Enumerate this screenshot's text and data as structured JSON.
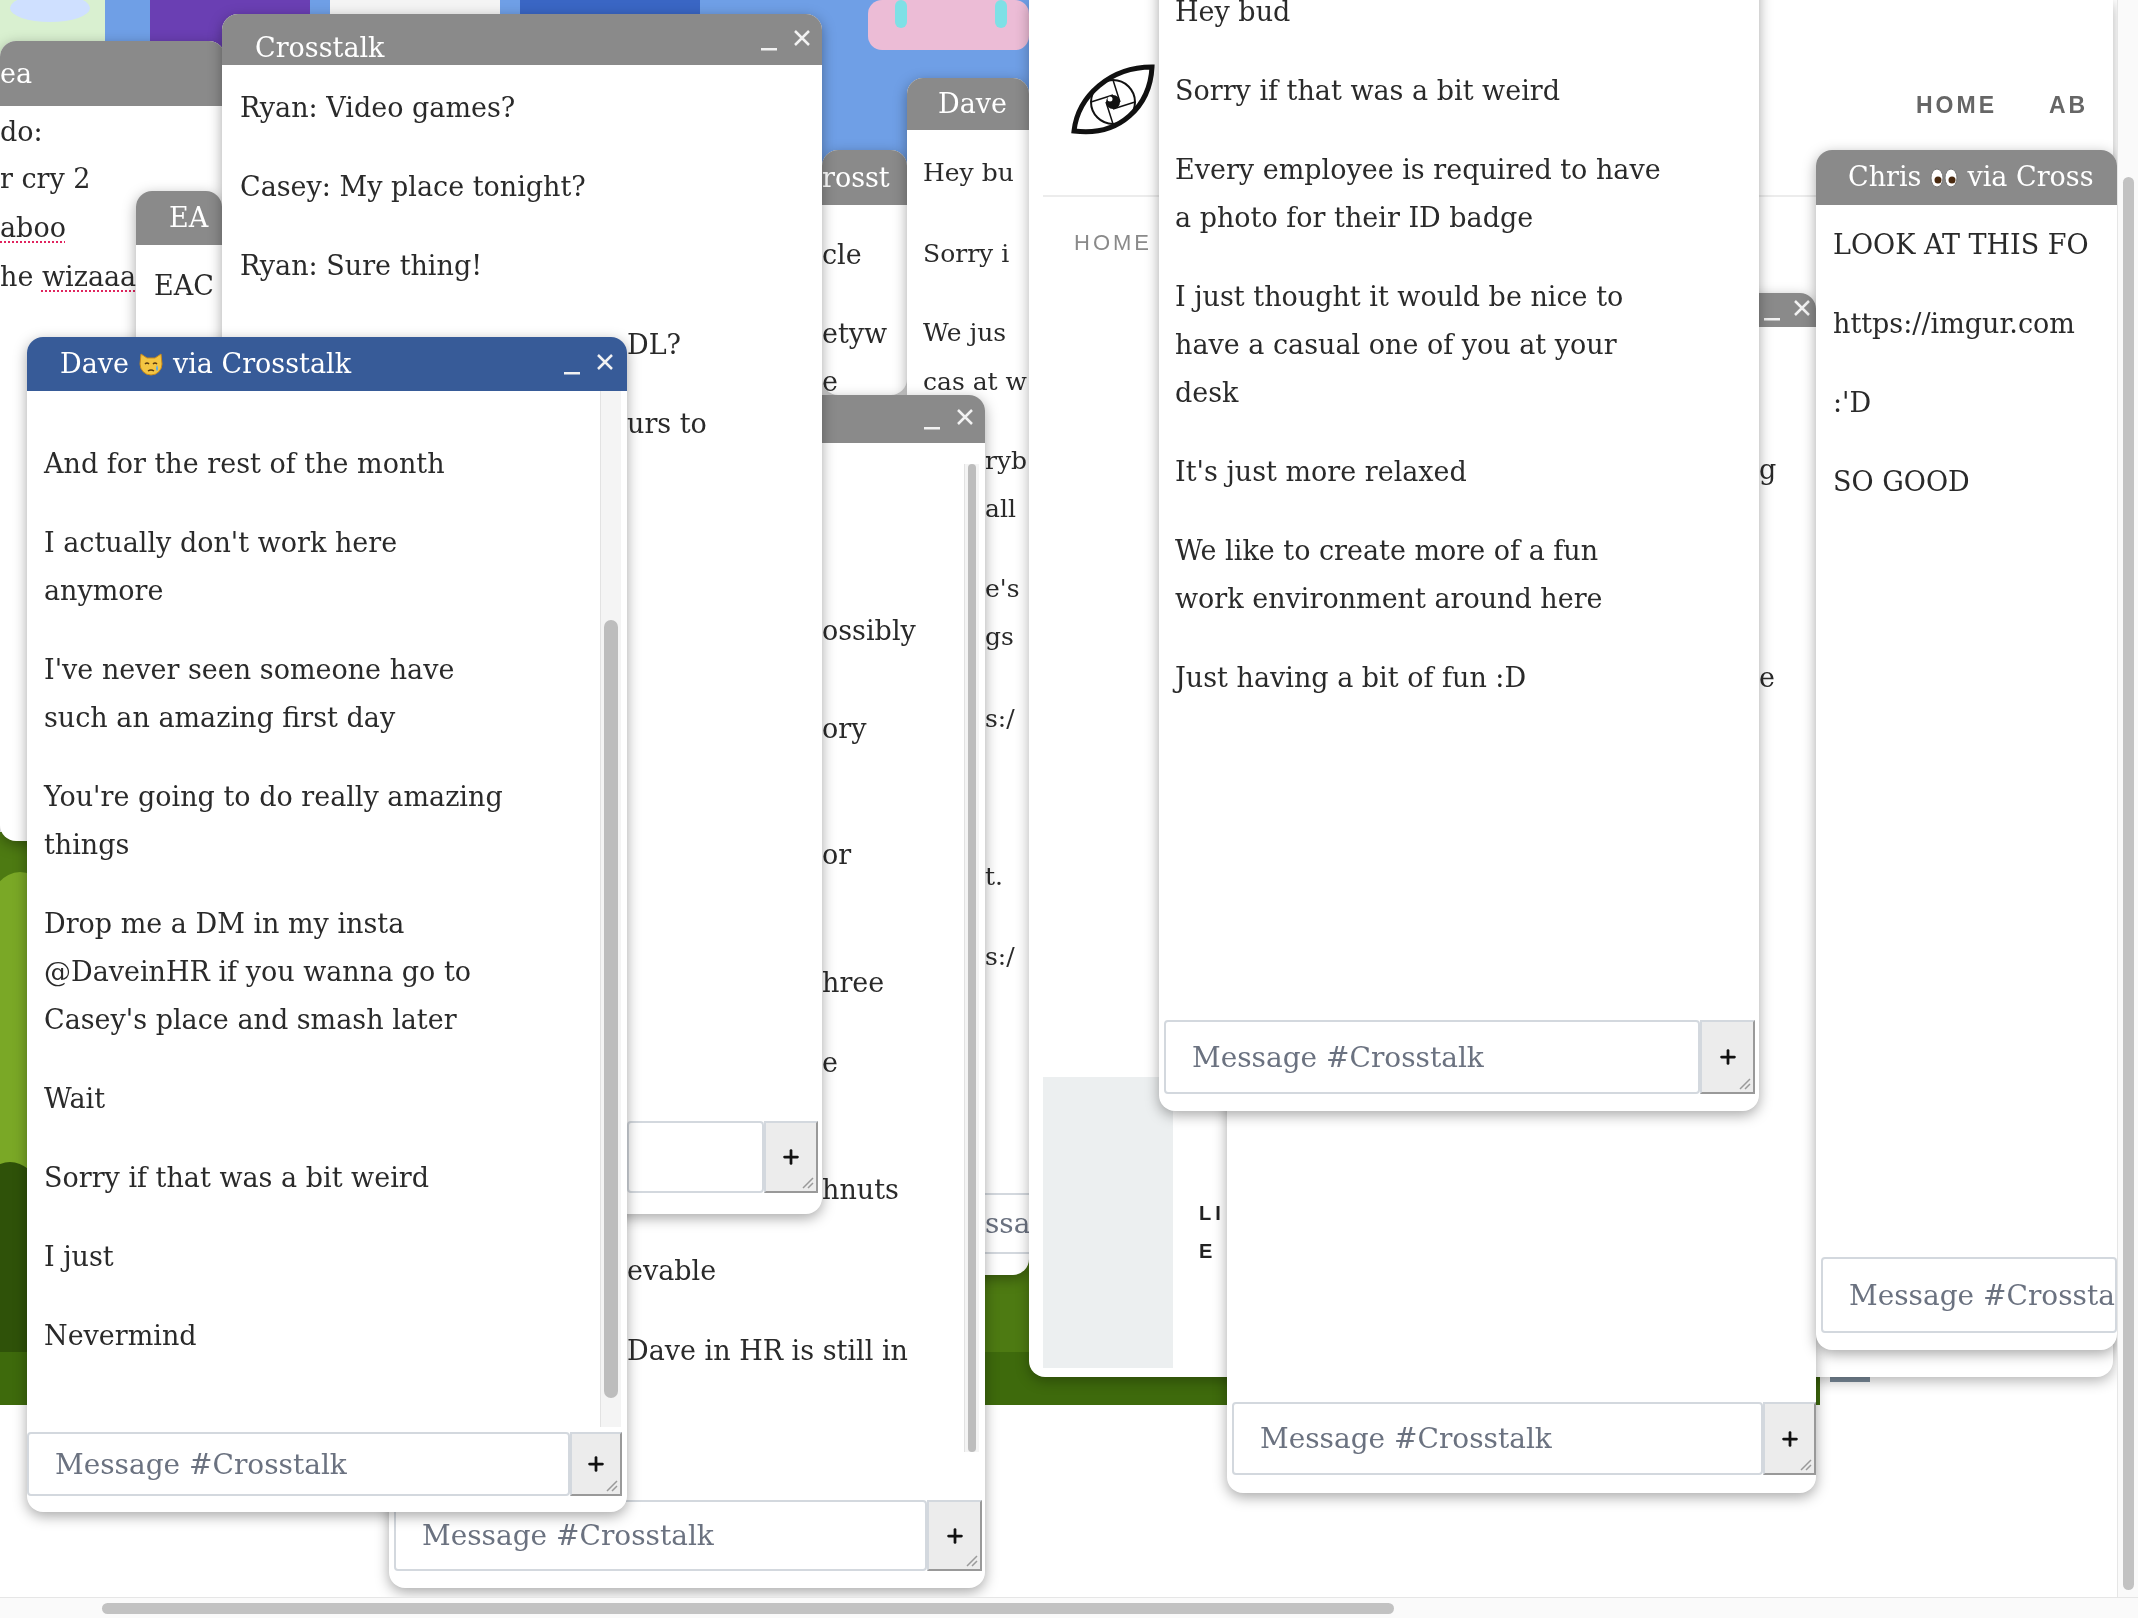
{
  "windows": [
    {
      "title": "ea",
      "active": false,
      "messages": [
        {
          "parts": [
            {
              "text": "do:",
              "misspelled": false
            }
          ]
        },
        {
          "parts": [
            {
              "text": "r cry 2",
              "misspelled": false
            }
          ]
        },
        {
          "parts": [
            {
              "text": "aboo",
              "misspelled": true
            }
          ]
        },
        {
          "parts": [
            {
              "text": "he ",
              "misspelled": false
            },
            {
              "text": "wizaaa",
              "misspelled": true
            }
          ]
        }
      ]
    },
    {
      "title": "EA",
      "active": false,
      "messages": [
        "EAC"
      ]
    },
    {
      "title": "rosst",
      "active": false,
      "messages": [
        "cle",
        "etyw",
        "e"
      ]
    },
    {
      "title": "Dave",
      "active": false,
      "messages": [
        "Hey bu",
        "Sorry i",
        "We jus",
        "cas at w",
        "ryb",
        "all",
        "e's",
        "gs",
        "s:/",
        "t.",
        "s:/"
      ],
      "composer": {
        "placeholder": "ssa"
      }
    },
    {
      "active": false,
      "messages": [
        "ossibly",
        "ory",
        "or",
        "hree",
        "e",
        "hnuts",
        "evable",
        "Dave in HR is still in"
      ],
      "composer": {
        "placeholder": "Message #Crosstalk"
      }
    },
    {
      "title": "Crosstalk",
      "active": false,
      "messages": [
        "Ryan: Video games?",
        "Casey: My place tonight?",
        "Ryan: Sure thing!",
        "DL?",
        "urs to"
      ]
    },
    {
      "active": false,
      "messages": [
        "g",
        "e"
      ],
      "composer": {
        "placeholder": "Message #Crosstalk"
      }
    },
    {
      "messages": [
        "Hey bud",
        "Sorry if that was a bit weird",
        [
          "Every employee is required to have",
          "a photo for their ID badge"
        ],
        [
          "I just thought it would be nice to",
          "have a casual one of you at your",
          "desk"
        ],
        "It's just more relaxed",
        [
          "We like to create more of a fun",
          "work environment around here"
        ],
        "Just having a bit of fun :D"
      ],
      "composer": {
        "placeholder": "Message #Crosstalk"
      }
    },
    {
      "title": [
        {
          "kind": "text",
          "text": "Chris"
        },
        {
          "kind": "eyes"
        },
        {
          "kind": "text",
          "text": "via Cross"
        }
      ],
      "active": false,
      "messages": [
        "LOOK AT THIS FO",
        "https://imgur.com",
        ":'D",
        "SO GOOD"
      ],
      "composer": {
        "placeholder": "Message #Crossta"
      }
    },
    {
      "title": [
        {
          "kind": "text",
          "text": "Dave"
        },
        {
          "kind": "cat"
        },
        {
          "kind": "text",
          "text": "via Crosstalk"
        }
      ],
      "active": true,
      "messages": [
        "And for the rest of the month",
        [
          "I actually don't work here",
          "anymore"
        ],
        [
          "I've never seen someone have",
          "such an amazing first day"
        ],
        [
          "You're going to do really amazing",
          "things"
        ],
        [
          "Drop me a DM in my insta",
          "@DaveinHR if you wanna go to",
          "Casey's place and smash later"
        ],
        "Wait",
        "Sorry if that was a bit weird",
        "I just",
        "Nevermind"
      ],
      "composer": {
        "placeholder": "Message #Crosstalk"
      }
    }
  ],
  "website": {
    "nav": [
      "HOME",
      "AB"
    ],
    "side_nav": "HOME",
    "card_label": [
      "LI",
      "E"
    ]
  }
}
